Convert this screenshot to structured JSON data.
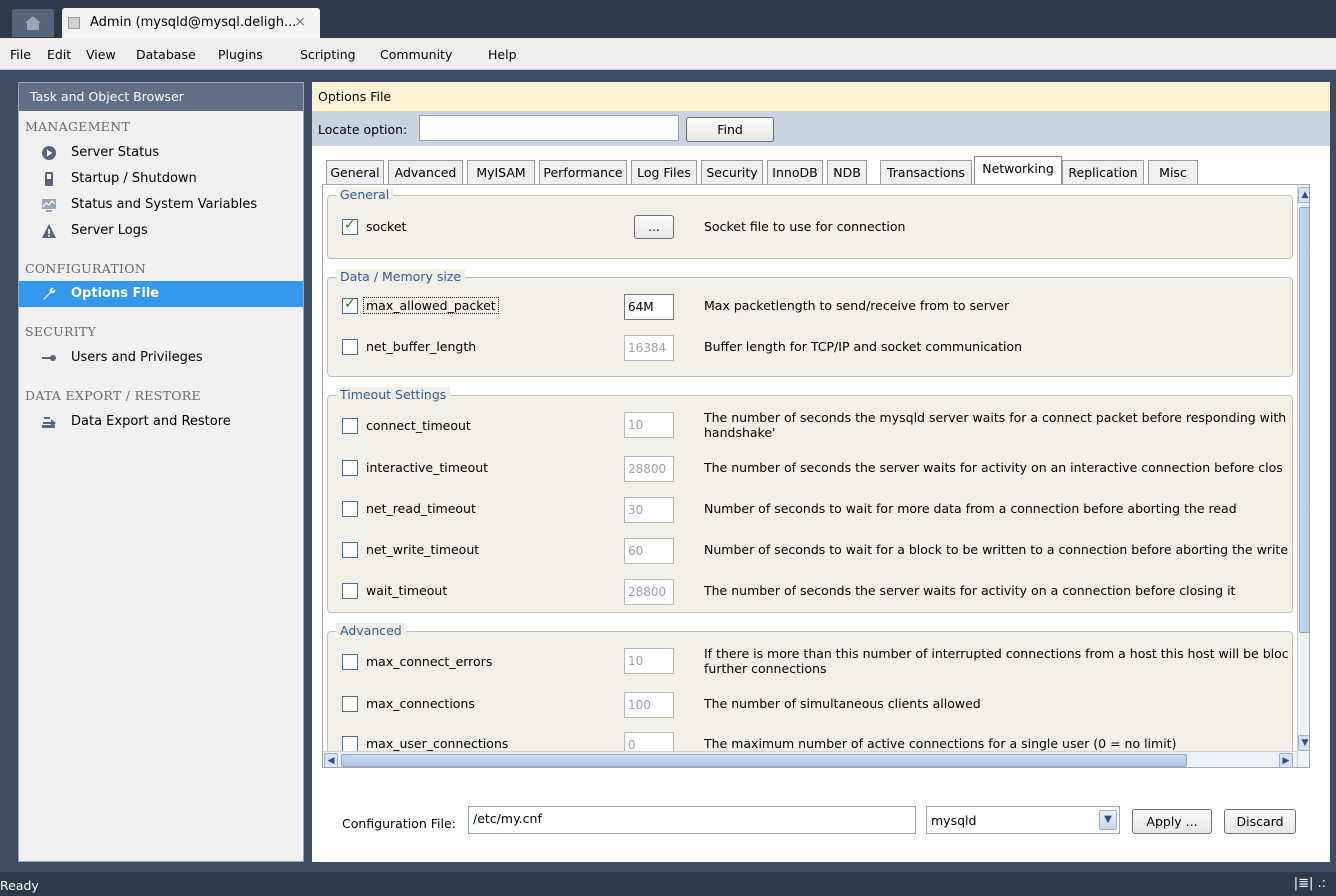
{
  "window": {
    "home_icon": "home-icon",
    "tab_title": "Admin (mysqld@mysql.deligh...",
    "tab_close": "×"
  },
  "menu": [
    "File",
    "Edit",
    "View",
    "Database",
    "Plugins",
    "Scripting",
    "Community",
    "Help"
  ],
  "sidebar": {
    "title": "Task and Object Browser",
    "sections": {
      "management": "MANAGEMENT",
      "configuration": "CONFIGURATION",
      "security": "SECURITY",
      "data_export": "DATA EXPORT / RESTORE"
    },
    "items": [
      {
        "label": "Server Status",
        "icon": "play-circle-icon"
      },
      {
        "label": "Startup / Shutdown",
        "icon": "power-switch-icon"
      },
      {
        "label": "Status and System Variables",
        "icon": "monitor-chart-icon"
      },
      {
        "label": "Server Logs",
        "icon": "warning-icon"
      },
      {
        "label": "Options File",
        "icon": "wrench-icon",
        "active": true
      },
      {
        "label": "Users and Privileges",
        "icon": "key-icon"
      },
      {
        "label": "Data Export and Restore",
        "icon": "export-arrow-icon"
      }
    ]
  },
  "main": {
    "header": "Options File",
    "locate": {
      "label": "Locate option:",
      "value": "",
      "find": "Find"
    },
    "tabs": [
      "General",
      "Advanced",
      "MyISAM",
      "Performance",
      "Log Files",
      "Security",
      "InnoDB",
      "NDB",
      "Transactions",
      "Networking",
      "Replication",
      "Misc"
    ],
    "active_tab": "Networking",
    "groups": {
      "general": {
        "title": "General",
        "rows": [
          {
            "name": "socket",
            "checked": true,
            "button": "...",
            "desc": "Socket file to use for connection"
          }
        ]
      },
      "data": {
        "title": "Data / Memory size",
        "rows": [
          {
            "name": "max_allowed_packet",
            "checked": true,
            "value": "64M",
            "desc": "Max packetlength to send/receive from to server"
          },
          {
            "name": "net_buffer_length",
            "checked": false,
            "value": "16384",
            "desc": "Buffer length for TCP/IP and socket communication"
          }
        ]
      },
      "timeout": {
        "title": "Timeout Settings",
        "rows": [
          {
            "name": "connect_timeout",
            "checked": false,
            "value": "10",
            "desc": "The number of seconds the mysqld server waits for a connect packet before responding with",
            "desc2": "handshake'"
          },
          {
            "name": "interactive_timeout",
            "checked": false,
            "value": "28800",
            "desc": "The number of seconds the server waits for activity on an interactive connection before clos"
          },
          {
            "name": "net_read_timeout",
            "checked": false,
            "value": "30",
            "desc": "Number of seconds to wait for more data from a connection before aborting the read"
          },
          {
            "name": "net_write_timeout",
            "checked": false,
            "value": "60",
            "desc": "Number of seconds to wait for a block to be written to a connection before aborting the write"
          },
          {
            "name": "wait_timeout",
            "checked": false,
            "value": "28800",
            "desc": "The number of seconds the server waits for activity on a connection before closing it"
          }
        ]
      },
      "advanced": {
        "title": "Advanced",
        "rows": [
          {
            "name": "max_connect_errors",
            "checked": false,
            "value": "10",
            "desc": "If there is more than this number of interrupted connections from a host this host will be bloc",
            "desc2": "further connections"
          },
          {
            "name": "max_connections",
            "checked": false,
            "value": "100",
            "desc": "The number of simultaneous clients allowed"
          },
          {
            "name": "max_user_connections",
            "checked": false,
            "value": "0",
            "desc": "The maximum number of active connections for a single user (0 = no limit)"
          }
        ]
      }
    },
    "config": {
      "label": "Configuration File:",
      "path": "/etc/my.cnf",
      "section": "mysqld",
      "apply": "Apply ...",
      "discard": "Discard"
    }
  },
  "status": {
    "text": "Ready",
    "right": "|≣| .:"
  }
}
